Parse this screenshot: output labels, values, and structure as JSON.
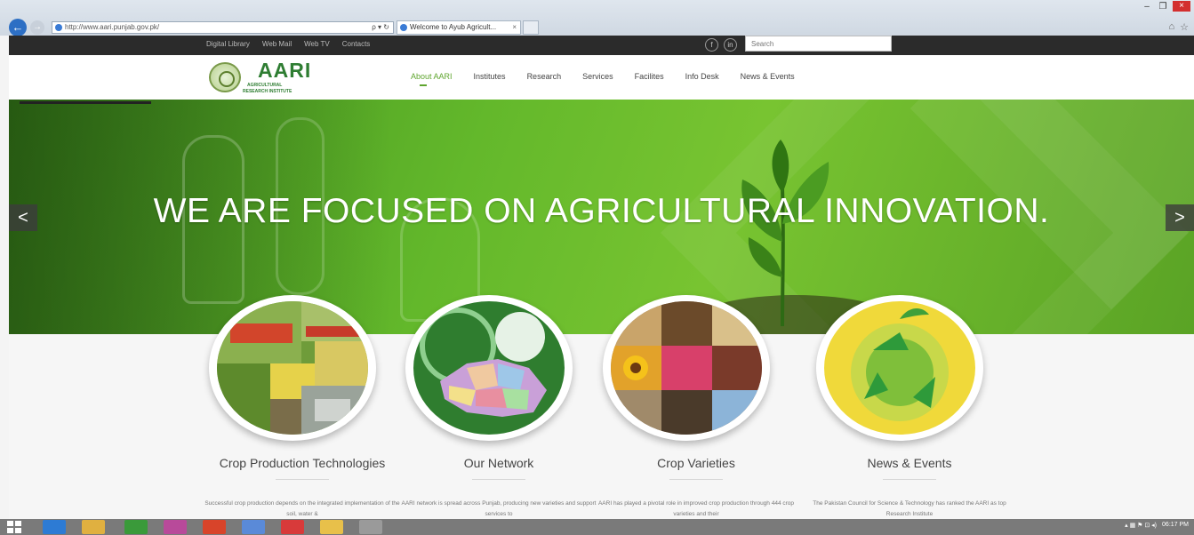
{
  "browser": {
    "address": "http://www.aari.punjab.gov.pk/",
    "address_controls": "ρ ▾ ↻",
    "tab_title": "Welcome to Ayub Agricult...",
    "tab_close": "×",
    "back_icon": "back-arrow-icon",
    "forward_icon": "forward-arrow-icon",
    "window_controls": {
      "minimize": "–",
      "maximize": "❐",
      "close": "×"
    },
    "tools": [
      "⌂",
      "☆"
    ]
  },
  "topbar": {
    "links": [
      "Digital Library",
      "Web Mail",
      "Web TV",
      "Contacts"
    ],
    "social": [
      "f",
      "in"
    ],
    "search_placeholder": "Search"
  },
  "logo": {
    "title": "AARI",
    "line1": "AGRICULTURAL",
    "line2": "RESEARCH INSTITUTE"
  },
  "nav": {
    "items": [
      "About AARI",
      "Institutes",
      "Research",
      "Services",
      "Facilites",
      "Info Desk",
      "News & Events"
    ],
    "active_index": 0
  },
  "hero": {
    "title": "WE ARE FOCUSED ON AGRICULTURAL INNOVATION.",
    "prev_label": "<",
    "next_label": ">"
  },
  "cards": [
    {
      "title": "Crop Production Technologies",
      "text": "Successful crop production depends on the integrated implementation of the soil, water &",
      "image_icon": "farm-machinery-collage"
    },
    {
      "title": "Our Network",
      "text": "AARI network is spread across Punjab, producing new varieties and support services to",
      "image_icon": "punjab-map"
    },
    {
      "title": "Crop Varieties",
      "text": "AARI has played a pivotal role in improved crop production through 444 crop varieties and their",
      "image_icon": "seeds-flowers-collage"
    },
    {
      "title": "News & Events",
      "text": "The Pakistan Council for Science & Technology has ranked the AARI as top Research Institute",
      "image_icon": "green-globe-recycle"
    }
  ],
  "taskbar": {
    "tray_text": "▴ ▦ ⚑ ⊡ ◂)",
    "clock": "06:17 PM"
  },
  "colors": {
    "accent": "#5fa52f",
    "logo_green": "#2e7d32",
    "topbar": "#2b2b2b",
    "hero_green": "#63b82b"
  }
}
